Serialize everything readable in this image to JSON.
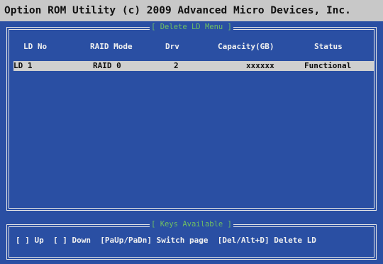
{
  "title": "Option ROM Utility (c) 2009 Advanced Micro Devices, Inc.",
  "delete_menu": {
    "title": "[ Delete LD Menu ]",
    "columns": [
      "LD No",
      "RAID Mode",
      "Drv",
      "Capacity(GB)",
      "Status"
    ],
    "rows": [
      [
        "LD  1",
        "RAID 0",
        "2",
        "xxxxxx",
        "Functional"
      ]
    ]
  },
  "keys": {
    "title": "[ Keys Available ]",
    "text": "[ ] Up  [ ] Down  [PaUp/PaDn] Switch page  [Del/Alt+D] Delete LD"
  },
  "colors": {
    "background": "#2a4fa3",
    "titlebar": "#c8c8c8",
    "panel_title": "#6fbf63",
    "selected_row": "#cfcfcf"
  }
}
